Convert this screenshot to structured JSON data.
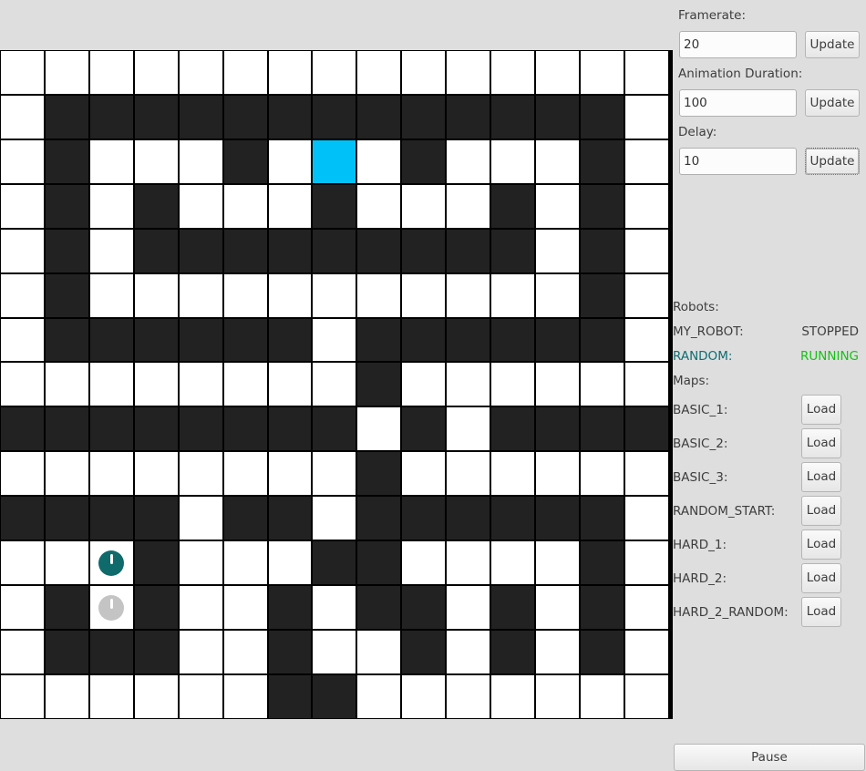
{
  "settings": {
    "framerate": {
      "label": "Framerate:",
      "value": "20",
      "button": "Update"
    },
    "animation_duration": {
      "label": "Animation Duration:",
      "value": "100",
      "button": "Update"
    },
    "delay": {
      "label": "Delay:",
      "value": "10",
      "button": "Update"
    }
  },
  "robots": {
    "heading": "Robots:",
    "items": [
      {
        "name": "MY_ROBOT:",
        "status": "STOPPED",
        "name_color": "#3d3d3d",
        "status_color": "#3d3d3d"
      },
      {
        "name": "RANDOM:",
        "status": "RUNNING",
        "name_color": "#0d6e72",
        "status_color": "#13c313"
      }
    ]
  },
  "maps": {
    "heading": "Maps:",
    "button": "Load",
    "items": [
      "BASIC_1:",
      "BASIC_2:",
      "BASIC_3:",
      "RANDOM_START:",
      "HARD_1:",
      "HARD_2:",
      "HARD_2_RANDOM:"
    ]
  },
  "pause_label": "Pause",
  "colors": {
    "wall": "#222222",
    "open": "#ffffff",
    "goal": "#00c2f8",
    "robot_active": "#0f6a6c",
    "robot_inactive": "#c4c4c4"
  },
  "maze": {
    "legend": "# wall, . open, G goal",
    "rows": [
      "...............",
      ".#############.",
      ".#...#.G.#...#.",
      ".#.#...#...#.#.",
      ".#.#########.#.",
      ".#...........#.",
      ".######.######.",
      "........#......",
      "########.#.####",
      "........#......",
      "####.##.######.",
      "...#...##....#.",
      ".#.#..#.##.#.#.",
      ".###..#..#.#.#.",
      "......##......."
    ],
    "robots": [
      {
        "name": "RANDOM",
        "row": 11,
        "col": 2,
        "color": "#0f6a6c",
        "heading": "north"
      },
      {
        "name": "MY_ROBOT",
        "row": 12,
        "col": 2,
        "color": "#c4c4c4",
        "heading": "north"
      }
    ]
  }
}
